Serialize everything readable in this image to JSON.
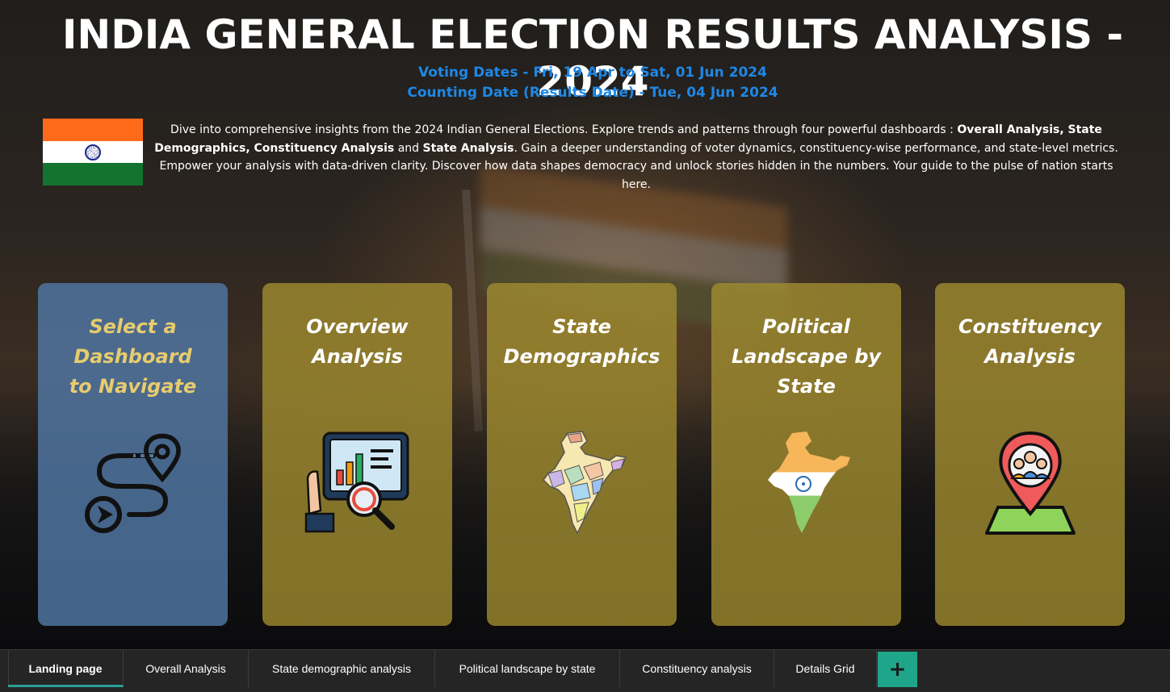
{
  "header": {
    "title": "INDIA GENERAL ELECTION RESULTS ANALYSIS - 2024",
    "voting_dates": "Voting Dates - Fri, 19 Apr to Sat, 01 Jun 2024",
    "counting_date": "Counting Date (Results Date) - Tue, 04 Jun 2024"
  },
  "intro": {
    "part1": "Dive into comprehensive insights from the 2024 Indian General Elections. Explore trends and patterns through four powerful dashboards : ",
    "bold1": "Overall Analysis, State Demographics, Constituency Analysis",
    "part2": " and ",
    "bold2": "State Analysis",
    "part3": ". Gain a deeper understanding of voter dynamics, constituency-wise performance, and state-level metrics. Empower your analysis with data-driven clarity. Discover how data shapes democracy and unlock stories hidden in the numbers. Your guide to the pulse of nation starts here."
  },
  "cards": [
    {
      "title": "Select a\nDashboard\nto Navigate",
      "icon": "route-pin-icon"
    },
    {
      "title": "Overview\nAnalysis",
      "icon": "analysis-screen-icon"
    },
    {
      "title": "State\nDemographics",
      "icon": "india-states-map-icon"
    },
    {
      "title": "Political\nLandscape by\nState",
      "icon": "india-tricolor-map-icon"
    },
    {
      "title": "Constituency\nAnalysis",
      "icon": "location-people-icon"
    }
  ],
  "tabs": [
    {
      "label": "Landing page",
      "active": true
    },
    {
      "label": "Overall Analysis"
    },
    {
      "label": "State demographic analysis"
    },
    {
      "label": "Political landscape by state"
    },
    {
      "label": "Constituency analysis"
    },
    {
      "label": "Details Grid"
    }
  ],
  "add_tab_label": "+",
  "colors": {
    "subtitle": "#1e88e5",
    "card_blue": "#5078a5",
    "card_gold": "#a08c30",
    "tab_accent": "#2aa197"
  }
}
